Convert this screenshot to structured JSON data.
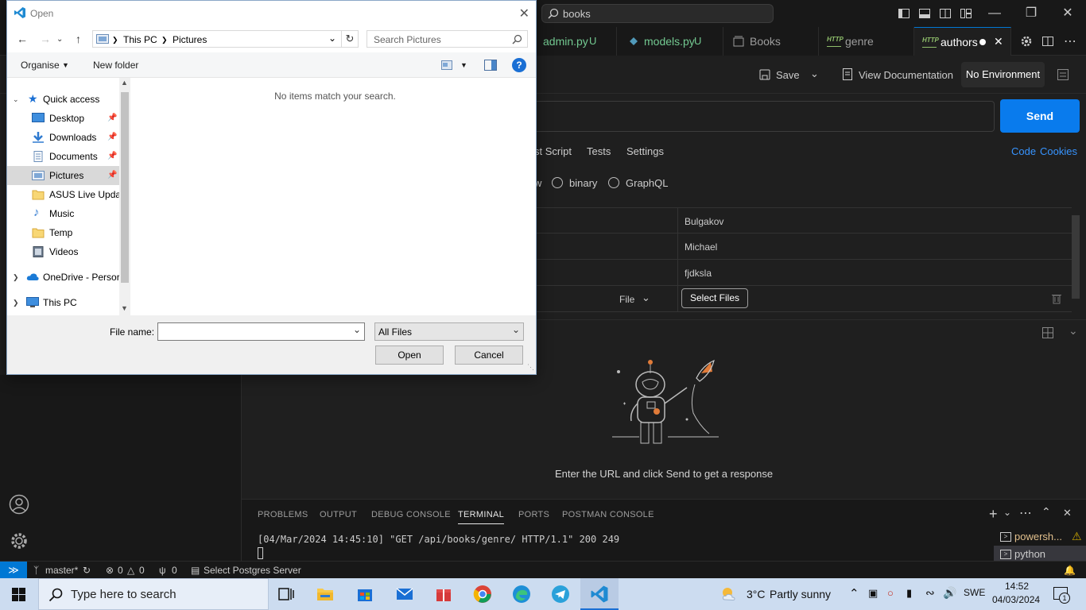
{
  "vscode": {
    "command_center": "books",
    "tabs": [
      {
        "label": "admin.py",
        "status": "U"
      },
      {
        "label": "models.py",
        "status": "U"
      },
      {
        "label": "Books"
      },
      {
        "label": "genre"
      },
      {
        "label": "authors"
      }
    ],
    "toolbar": {
      "save": "Save",
      "view_docs": "View Documentation",
      "environment": "No Environment"
    },
    "request": {
      "send": "Send",
      "tabs": [
        "st Script",
        "Tests",
        "Settings"
      ],
      "links": [
        "Code",
        "Cookies"
      ],
      "body_types": [
        "w",
        "binary",
        "GraphQL"
      ],
      "rows": [
        {
          "value": "Bulgakov"
        },
        {
          "value": "Michael"
        },
        {
          "value": "fjdksla"
        }
      ],
      "file_type": "File",
      "select_files": "Select Files"
    },
    "response_message": "Enter the URL and click Send to get a response",
    "panel": {
      "tabs": [
        "PROBLEMS",
        "OUTPUT",
        "DEBUG CONSOLE",
        "TERMINAL",
        "PORTS",
        "POSTMAN CONSOLE"
      ],
      "active_tab": "TERMINAL",
      "terminal_line": "[04/Mar/2024 14:45:10] \"GET /api/books/genre/ HTTP/1.1\" 200 249",
      "terminals": [
        "powersh...",
        "python"
      ]
    },
    "statusbar": {
      "branch": "master*",
      "errors": "0",
      "warnings": "0",
      "ports": "0",
      "postgres": "Select Postgres Server"
    }
  },
  "dialog": {
    "title": "Open",
    "breadcrumb": [
      "This PC",
      "Pictures"
    ],
    "search_placeholder": "Search Pictures",
    "organise": "Organise",
    "new_folder": "New folder",
    "nav_items": [
      {
        "label": "Quick access",
        "icon": "star-icon"
      },
      {
        "label": "Desktop",
        "icon": "desktop-icon"
      },
      {
        "label": "Downloads",
        "icon": "download-icon"
      },
      {
        "label": "Documents",
        "icon": "document-icon"
      },
      {
        "label": "Pictures",
        "icon": "pictures-icon"
      },
      {
        "label": "ASUS Live Updat",
        "icon": "folder-icon"
      },
      {
        "label": "Music",
        "icon": "music-icon"
      },
      {
        "label": "Temp",
        "icon": "folder-icon"
      },
      {
        "label": "Videos",
        "icon": "video-icon"
      },
      {
        "label": "OneDrive - Persor",
        "icon": "cloud-icon"
      },
      {
        "label": "This PC",
        "icon": "computer-icon"
      }
    ],
    "empty_message": "No items match your search.",
    "file_name_label": "File name:",
    "file_name_value": "",
    "file_type": "All Files",
    "open_button": "Open",
    "cancel_button": "Cancel"
  },
  "taskbar": {
    "search_placeholder": "Type here to search",
    "weather_temp": "3°C",
    "weather_desc": "Partly sunny",
    "language": "SWE",
    "time": "14:52",
    "date": "04/03/2024",
    "notification_count": "1"
  },
  "colors": {
    "accent": "#0078d4",
    "send_button": "#097bed",
    "editor_bg": "#1f1f1f",
    "taskbar_bg": "#ccdcf0"
  }
}
